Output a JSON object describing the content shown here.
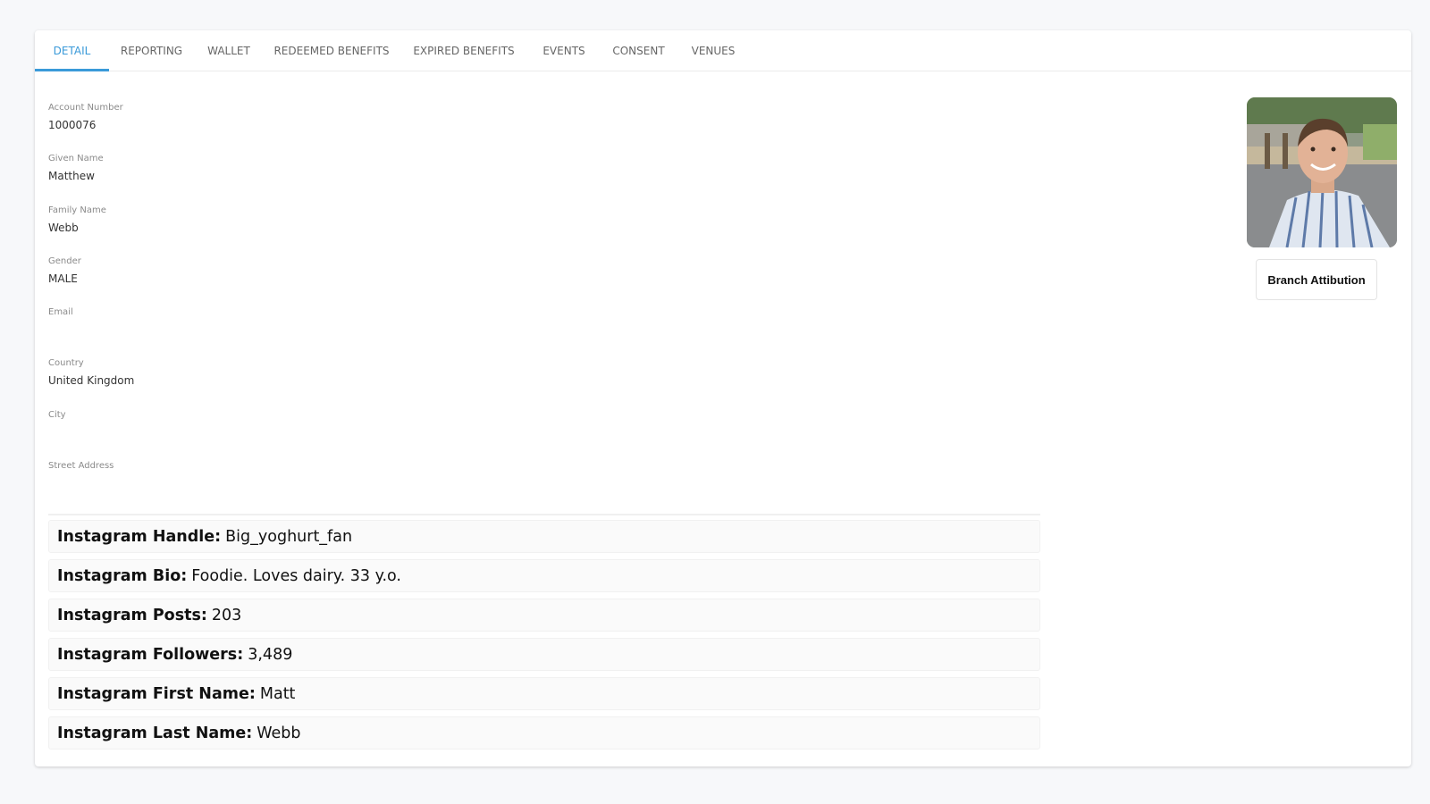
{
  "tabs": [
    {
      "label": "DETAIL",
      "active": true
    },
    {
      "label": "REPORTING",
      "active": false
    },
    {
      "label": "WALLET",
      "active": false
    },
    {
      "label": "REDEEMED BENEFITS",
      "active": false
    },
    {
      "label": "EXPIRED BENEFITS",
      "active": false
    },
    {
      "label": "EVENTS",
      "active": false
    },
    {
      "label": "CONSENT",
      "active": false
    },
    {
      "label": "VENUES",
      "active": false
    }
  ],
  "accent_color": "#3a9ad9",
  "details": [
    {
      "label": "Account Number",
      "value": "1000076"
    },
    {
      "label": "Given Name",
      "value": "Matthew"
    },
    {
      "label": "Family Name",
      "value": "Webb"
    },
    {
      "label": "Gender",
      "value": "MALE"
    },
    {
      "label": "Email",
      "value": "",
      "redacted": true
    },
    {
      "label": "Country",
      "value": "United Kingdom"
    },
    {
      "label": "City",
      "value": ""
    },
    {
      "label": "Street Address",
      "value": "",
      "redacted": true
    }
  ],
  "instagram": [
    {
      "label": "Instagram Handle:",
      "value": "Big_yoghurt_fan"
    },
    {
      "label": "Instagram Bio:",
      "value": "Foodie. Loves dairy. 33 y.o."
    },
    {
      "label": "Instagram Posts:",
      "value": "203"
    },
    {
      "label": "Instagram Followers:",
      "value": "3,489"
    },
    {
      "label": "Instagram First Name:",
      "value": "Matt"
    },
    {
      "label": "Instagram Last Name:",
      "value": "Webb"
    }
  ],
  "profile": {
    "photo_alt": "Profile photo of Matthew Webb",
    "branch_button_label": "Branch Attibution"
  }
}
